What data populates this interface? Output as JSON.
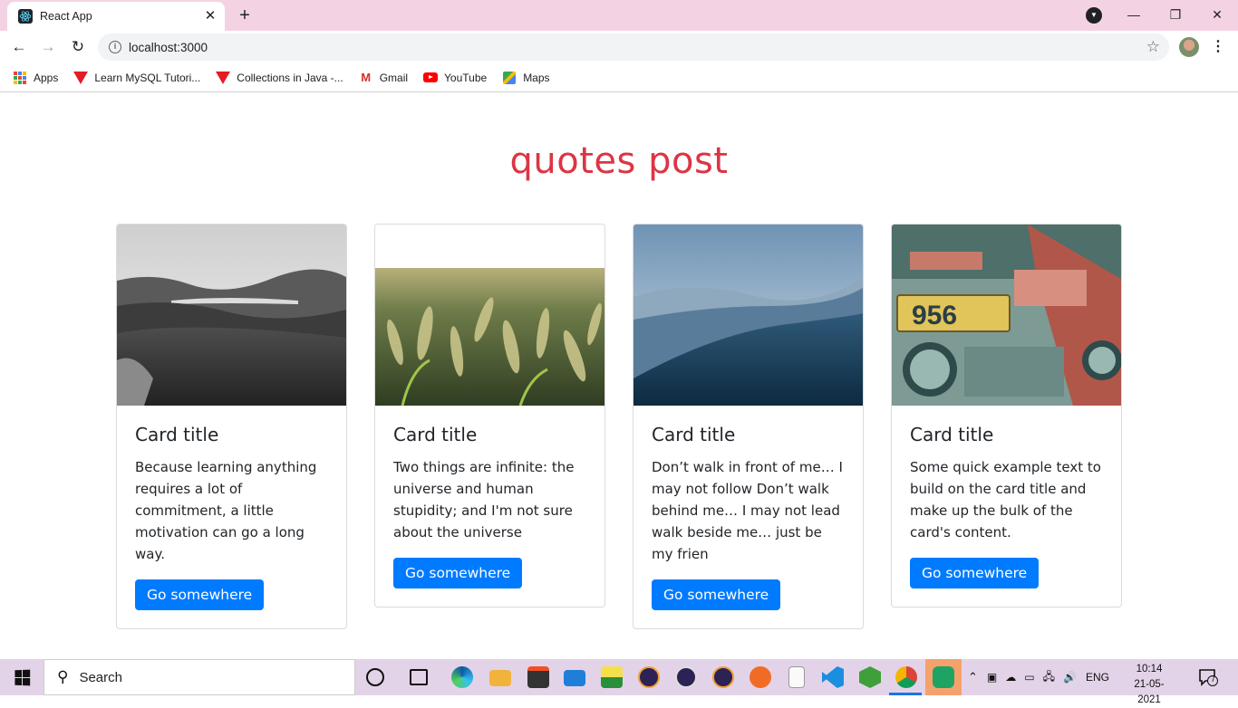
{
  "browser": {
    "tab_title": "React App",
    "tab_close": "✕",
    "new_tab": "+",
    "url": "localhost:3000",
    "window": {
      "minimize": "—",
      "restore": "❐",
      "close": "✕"
    },
    "bookmarks": [
      {
        "label": "Apps",
        "icon": "apps-grid-icon"
      },
      {
        "label": "Learn MySQL Tutori...",
        "icon": "javatpoint-icon"
      },
      {
        "label": "Collections in Java -...",
        "icon": "javatpoint-icon"
      },
      {
        "label": "Gmail",
        "icon": "gmail-icon"
      },
      {
        "label": "YouTube",
        "icon": "youtube-icon"
      },
      {
        "label": "Maps",
        "icon": "maps-icon"
      }
    ]
  },
  "page": {
    "title": "quotes post",
    "title_color": "#dc3545",
    "button_color": "#007bff",
    "cards": [
      {
        "title": "Card title",
        "text": "Because learning anything requires a lot of commitment, a little motivation can go a long way.",
        "button": "Go somewhere",
        "image": "misty-valley-landscape"
      },
      {
        "title": "Card title",
        "text": "Two things are infinite: the universe and human stupidity; and I'm not sure about the universe",
        "button": "Go somewhere",
        "image": "wheat-field"
      },
      {
        "title": "Card title",
        "text": "Don’t walk in front of me… I may not follow Don’t walk behind me… I may not lead walk beside me… just be my frien",
        "button": "Go somewhere",
        "image": "blue-mountains"
      },
      {
        "title": "Card title",
        "text": "Some quick example text to build on the card title and make up the bulk of the card's content.",
        "button": "Go somewhere",
        "image": "tuk-tuk-956"
      }
    ]
  },
  "taskbar": {
    "search_placeholder": "Search",
    "language": "ENG",
    "time": "10:14",
    "date": "21-05-2021",
    "notification_count": "7"
  }
}
